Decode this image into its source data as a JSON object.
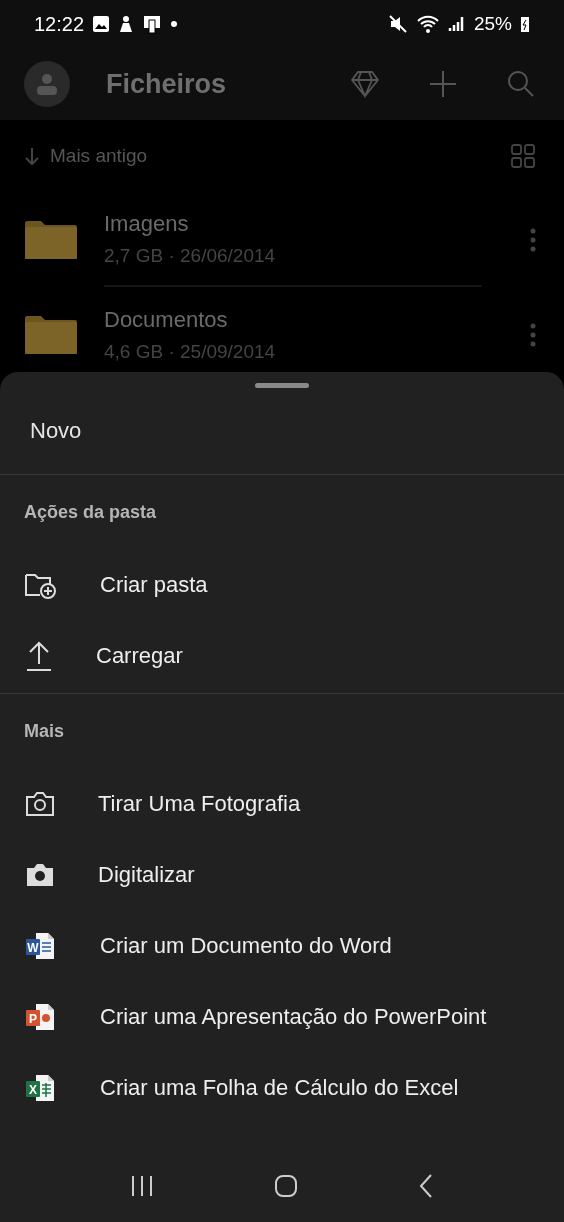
{
  "status_bar": {
    "time": "12:22",
    "battery": "25%"
  },
  "app_bar": {
    "title": "Ficheiros"
  },
  "sort": {
    "label": "Mais antigo"
  },
  "files": [
    {
      "name": "Imagens",
      "meta": "2,7 GB · 26/06/2014"
    },
    {
      "name": "Documentos",
      "meta": "4,6 GB · 25/09/2014"
    }
  ],
  "sheet": {
    "title": "Novo",
    "sections": [
      {
        "heading": "Ações da pasta",
        "actions": [
          {
            "kind": "folder-add",
            "label": "Criar pasta"
          },
          {
            "kind": "upload",
            "label": "Carregar"
          }
        ]
      },
      {
        "heading": "Mais",
        "actions": [
          {
            "kind": "camera",
            "label": "Tirar Uma Fotografia"
          },
          {
            "kind": "scan",
            "label": "Digitalizar"
          },
          {
            "kind": "word",
            "badge": "W",
            "label": "Criar um Documento do Word"
          },
          {
            "kind": "powerpoint",
            "badge": "P",
            "label": "Criar uma Apresentação do PowerPoint"
          },
          {
            "kind": "excel",
            "badge": "X",
            "label": "Criar uma Folha de Cálculo do Excel"
          }
        ]
      }
    ]
  }
}
